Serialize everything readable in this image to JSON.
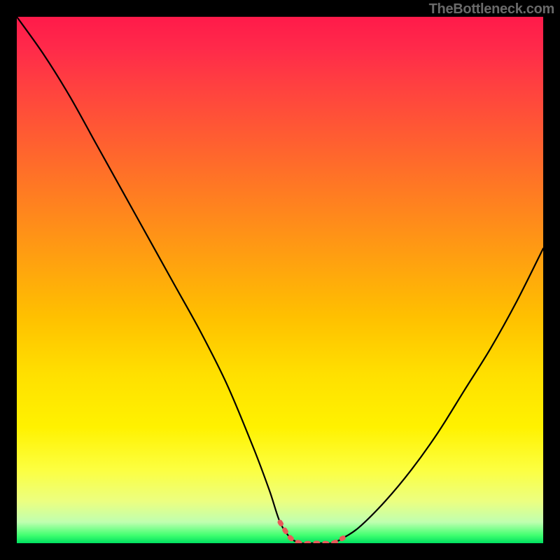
{
  "watermark": "TheBottleneck.com",
  "chart_data": {
    "type": "line",
    "title": "",
    "xlabel": "",
    "ylabel": "",
    "xlim": [
      0,
      100
    ],
    "ylim": [
      0,
      100
    ],
    "x": [
      0,
      5,
      10,
      15,
      20,
      25,
      30,
      35,
      40,
      45,
      48,
      50,
      52,
      54,
      56,
      58,
      60,
      62,
      65,
      70,
      75,
      80,
      85,
      90,
      95,
      100
    ],
    "values": [
      100,
      93,
      85,
      76,
      67,
      58,
      49,
      40,
      30,
      18,
      10,
      4,
      1,
      0,
      0,
      0,
      0,
      1,
      3,
      8,
      14,
      21,
      29,
      37,
      46,
      56
    ],
    "highlight_range_x": [
      50,
      62
    ],
    "note": "V-shaped bottleneck curve over rainbow gradient; minimum (optimal) region highlighted with red dashed band near x≈50–62."
  }
}
